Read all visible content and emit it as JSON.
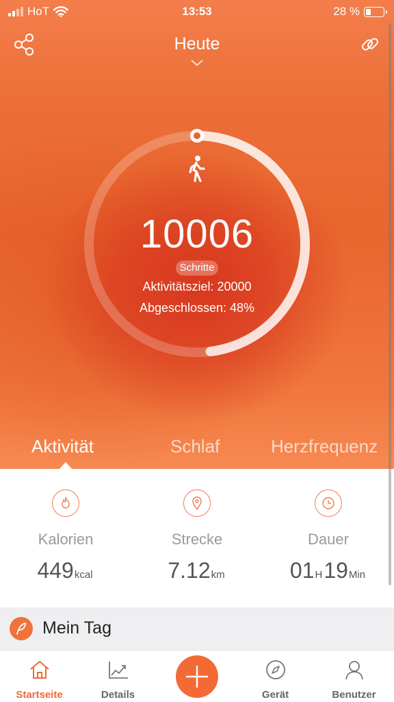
{
  "status_bar": {
    "carrier": "HoT",
    "time": "13:53",
    "battery": "28 %",
    "battery_level": 0.28
  },
  "header": {
    "title": "Heute"
  },
  "activity_ring": {
    "steps": "10006",
    "unit": "Schritte",
    "goal_text": "Aktivitätsziel: 20000",
    "completed_text": "Abgeschlossen: 48%",
    "progress": 0.48
  },
  "tabs": [
    {
      "label": "Aktivität",
      "active": true
    },
    {
      "label": "Schlaf",
      "active": false
    },
    {
      "label": "Herzfrequenz",
      "active": false
    }
  ],
  "stats": [
    {
      "label": "Kalorien",
      "value": "449",
      "unit": "kcal",
      "icon": "flame-icon"
    },
    {
      "label": "Strecke",
      "value": "7.12",
      "unit": "km",
      "icon": "location-pin-icon"
    },
    {
      "label": "Dauer",
      "hours": "01",
      "hours_unit": "H",
      "minutes": "19",
      "minutes_unit": "Min",
      "icon": "clock-icon"
    }
  ],
  "my_day": {
    "label": "Mein Tag"
  },
  "tab_bar": {
    "items": [
      {
        "label": "Startseite",
        "icon": "home-icon",
        "active": true
      },
      {
        "label": "Details",
        "icon": "chart-icon",
        "active": false
      },
      {
        "label": "Gerät",
        "icon": "compass-icon",
        "active": false
      },
      {
        "label": "Benutzer",
        "icon": "user-icon",
        "active": false
      }
    ]
  },
  "colors": {
    "accent": "#f36a35",
    "hero_dark": "#d8381f",
    "hero_light": "#f37e4c"
  }
}
